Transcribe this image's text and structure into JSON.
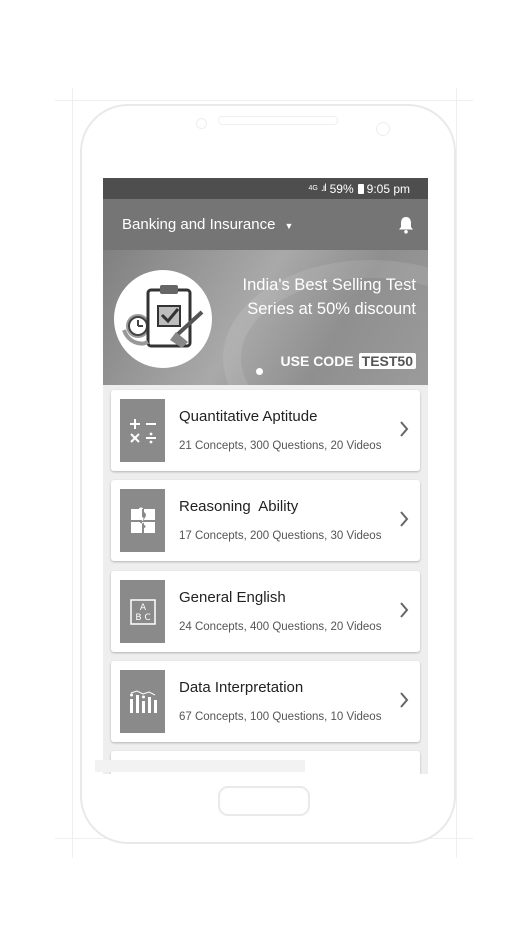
{
  "status_bar": {
    "network": "4G",
    "battery": "59%",
    "time": "9:05 pm"
  },
  "app_bar": {
    "title": "Banking and Insurance"
  },
  "banner": {
    "tagline_line1": "India's Best Selling Test",
    "tagline_line2": "Series at 50% discount",
    "code_label": "USE CODE",
    "code_value": "TEST50"
  },
  "subjects": [
    {
      "name": "Quantitative Aptitude",
      "meta": "21 Concepts, 300 Questions, 20 Videos",
      "icon": "math-operators-icon"
    },
    {
      "name": "Reasoning  Ability",
      "meta": "17 Concepts, 200 Questions, 30 Videos",
      "icon": "puzzle-icon"
    },
    {
      "name": "General English",
      "meta": "24 Concepts, 400 Questions, 20 Videos",
      "icon": "abc-icon"
    },
    {
      "name": "Data Interpretation",
      "meta": "67 Concepts, 100 Questions, 10 Videos",
      "icon": "bar-chart-icon"
    }
  ]
}
